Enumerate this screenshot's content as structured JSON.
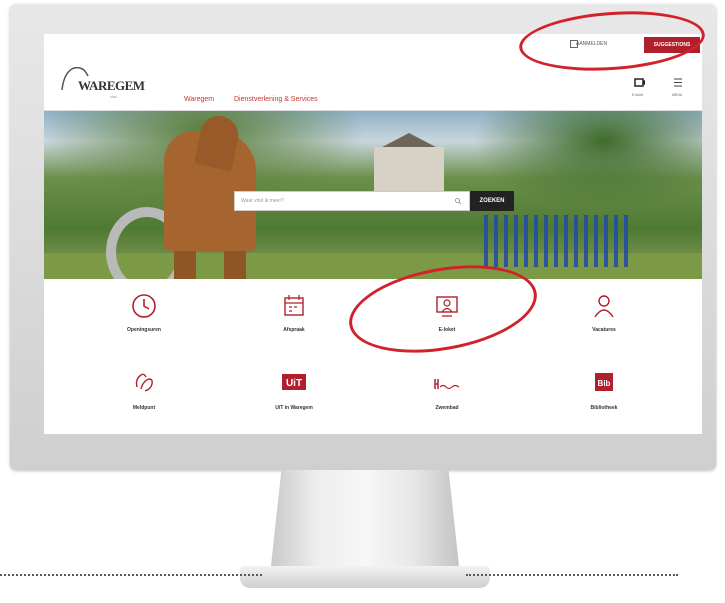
{
  "window": {
    "title": "Waregem website"
  },
  "utilbar": {
    "link_label": "AANMELDEN",
    "button_label": "SUGGESTIONS"
  },
  "logo": {
    "text": "WAREGEM",
    "subtitle": "stad"
  },
  "nav": {
    "items": [
      "Waregem",
      "Dienstverlening & Services"
    ],
    "icons": [
      {
        "icon": "camera-icon",
        "label": "E-loket"
      },
      {
        "icon": "menu-icon",
        "label": "MENU"
      }
    ]
  },
  "search": {
    "placeholder": "Waar vind ik meer?",
    "button_label": "ZOEKEN"
  },
  "tiles": [
    {
      "icon": "clock-icon",
      "label": "Openingsuren"
    },
    {
      "icon": "calendar-icon",
      "label": "Afspraak"
    },
    {
      "icon": "eloket-icon",
      "label": "E-loket"
    },
    {
      "icon": "person-icon",
      "label": "Vacatures"
    },
    {
      "icon": "hands-icon",
      "label": "Meldpunt"
    },
    {
      "icon": "uit-logo-icon",
      "label": "UiT in Waregem"
    },
    {
      "icon": "zwembad-logo-icon",
      "label": "Zwembad"
    },
    {
      "icon": "bib-logo-icon",
      "label": "Bibliotheek"
    }
  ],
  "colors": {
    "accent": "#b01f2c",
    "annotation": "#d1222b"
  }
}
